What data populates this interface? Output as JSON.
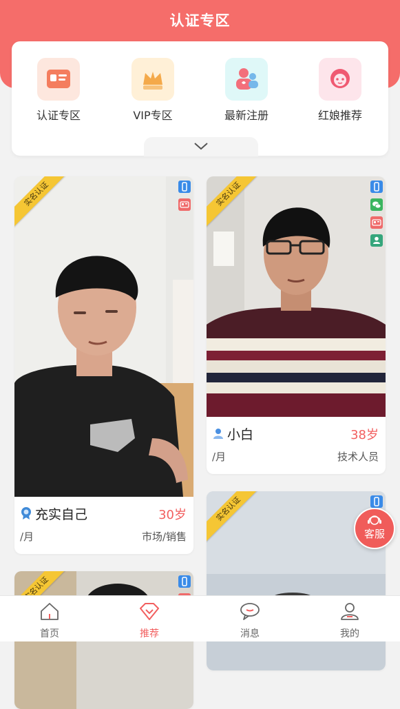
{
  "page": {
    "title": "认证专区"
  },
  "quick_entries": [
    {
      "label": "认证专区",
      "icon": "certificate-card-icon",
      "color": "#f47d5e"
    },
    {
      "label": "VIP专区",
      "icon": "crown-icon",
      "color": "#f4a94a"
    },
    {
      "label": "最新注册",
      "icon": "new-users-icon",
      "color": "#f36f7b"
    },
    {
      "label": "红娘推荐",
      "icon": "matchmaker-icon",
      "color": "#ef5a72"
    }
  ],
  "badge_label": "实名认证",
  "profiles": [
    {
      "name": "充实自己",
      "age": "30岁",
      "income": "/月",
      "job": "市场/销售",
      "name_icon": "member-medal-icon"
    },
    {
      "name": "小白",
      "age": "38岁",
      "income": "/月",
      "job": "技术人员",
      "name_icon": "male-user-icon"
    }
  ],
  "float_button": {
    "label": "客服"
  },
  "tabbar": {
    "items": [
      {
        "label": "首页",
        "icon": "home-icon"
      },
      {
        "label": "推荐",
        "icon": "recommend-diamond-icon",
        "active": true
      },
      {
        "label": "消息",
        "icon": "message-bubble-icon"
      },
      {
        "label": "我的",
        "icon": "profile-icon"
      }
    ]
  },
  "colors": {
    "brand": "#f56d6a",
    "accent": "#f25f5f",
    "ribbon": "#f5c634"
  }
}
